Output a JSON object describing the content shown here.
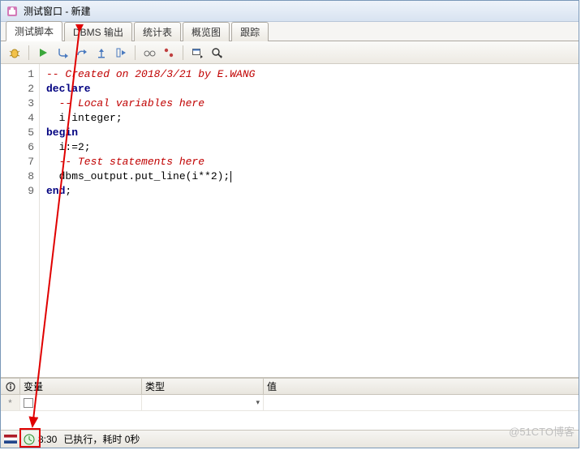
{
  "window": {
    "title": "测试窗口 - 新建"
  },
  "tabs": [
    {
      "label": "测试脚本",
      "active": true
    },
    {
      "label": "DBMS 输出"
    },
    {
      "label": "统计表"
    },
    {
      "label": "概览图"
    },
    {
      "label": "跟踪"
    }
  ],
  "code": {
    "lines": [
      {
        "n": "1",
        "kind": "comment",
        "text": "-- Created on 2018/3/21 by E.WANG"
      },
      {
        "n": "2",
        "kind": "keyword",
        "text": "declare"
      },
      {
        "n": "3",
        "kind": "comment",
        "text": "  -- Local variables here"
      },
      {
        "n": "4",
        "kind": "plain",
        "text": "  i integer;"
      },
      {
        "n": "5",
        "kind": "keyword",
        "text": "begin"
      },
      {
        "n": "6",
        "kind": "plain",
        "text": "  i:=2;"
      },
      {
        "n": "7",
        "kind": "comment",
        "text": "  -- Test statements here"
      },
      {
        "n": "8",
        "kind": "plain",
        "text": "  dbms_output.put_line(i**2);",
        "caret": true
      },
      {
        "n": "9",
        "kind": "mixed",
        "keyword": "end",
        "rest": ";"
      }
    ]
  },
  "varpanel": {
    "headers": {
      "c2": "变量",
      "c3": "类型",
      "c4": "值"
    },
    "rows": [
      {
        "marker": "*",
        "c2": "",
        "c3": "",
        "c4": ""
      }
    ]
  },
  "status": {
    "time": "8:30",
    "msg": "已执行，耗时 0秒"
  },
  "watermark": "@51CTO博客"
}
